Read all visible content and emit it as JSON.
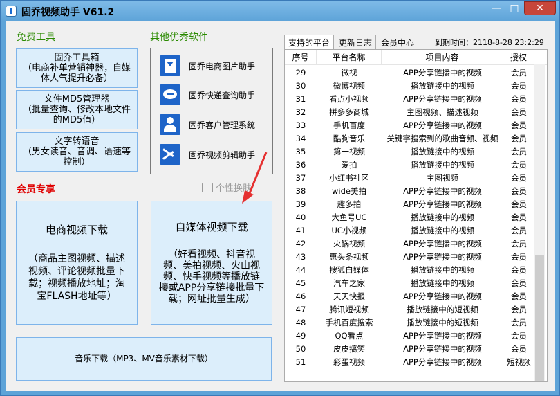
{
  "window": {
    "title": "固乔视频助手 V61.2",
    "minimize": "—",
    "maximize": "□",
    "close": "✕"
  },
  "free_tools": {
    "heading": "免费工具",
    "items": [
      {
        "line1": "固乔工具箱",
        "line2": "（电商补单营销神器，自媒",
        "line3": "体人气提升必备）"
      },
      {
        "line1": "文件MD5管理器",
        "line2": "（批量查询、修改本地文件",
        "line3": "的MD5值）"
      },
      {
        "line1": "文字转语音",
        "line2": "（男女读音、音调、语速等",
        "line3": "控制）"
      }
    ]
  },
  "other_software": {
    "heading": "其他优秀软件",
    "items": [
      {
        "label": "固乔电商图片助手",
        "icon": "download-icon"
      },
      {
        "label": "固乔快递查询助手",
        "icon": "express-icon"
      },
      {
        "label": "固乔客户管理系统",
        "icon": "customer-icon"
      },
      {
        "label": "固乔视频剪辑助手",
        "icon": "scissors-icon"
      }
    ]
  },
  "member": {
    "heading": "会员专享",
    "ecommerce": {
      "title": "电商视频下载",
      "l1": "（商品主图视频、描述",
      "l2": "视频、评论视频批量下",
      "l3": "载；视频播放地址；淘",
      "l4": "宝FLASH地址等）"
    },
    "selfmedia": {
      "title": "自媒体视频下载",
      "l1": "（好看视频、抖音视",
      "l2": "频、美拍视频、火山视",
      "l3": "频、快手视频等播放链",
      "l4": "接或APP分享链接批量下",
      "l5": "载；网址批量生成）"
    },
    "music": "音乐下载（MP3、MV音乐素材下载）"
  },
  "skin_label": "个性换肤",
  "tabs": [
    "支持的平台",
    "更新日志",
    "会员中心"
  ],
  "expiry": "到期时间：2118-8-28 23:2:29",
  "table": {
    "headers": [
      "序号",
      "平台名称",
      "项目内容",
      "授权"
    ],
    "rows": [
      [
        "29",
        "微视",
        "APP分享链接中的视频",
        "会员"
      ],
      [
        "30",
        "微博视频",
        "播放链接中的视频",
        "会员"
      ],
      [
        "31",
        "看点小视频",
        "APP分享链接中的视频",
        "会员"
      ],
      [
        "32",
        "拼多多商城",
        "主图视频、描述视频",
        "会员"
      ],
      [
        "33",
        "手机百度",
        "APP分享链接中的视频",
        "会员"
      ],
      [
        "34",
        "酷狗音乐",
        "关键字搜索到的歌曲音频、视频",
        "会员"
      ],
      [
        "35",
        "第一视频",
        "播放链接中的视频",
        "会员"
      ],
      [
        "36",
        "爱拍",
        "播放链接中的视频",
        "会员"
      ],
      [
        "37",
        "小红书社区",
        "主图视频",
        "会员"
      ],
      [
        "38",
        "wide美拍",
        "APP分享链接中的视频",
        "会员"
      ],
      [
        "39",
        "趣多拍",
        "APP分享链接中的视频",
        "会员"
      ],
      [
        "40",
        "大鱼号UC",
        "播放链接中的视频",
        "会员"
      ],
      [
        "41",
        "UC小视频",
        "播放链接中的视频",
        "会员"
      ],
      [
        "42",
        "火锅视频",
        "APP分享链接中的视频",
        "会员"
      ],
      [
        "43",
        "惠头条视频",
        "APP分享链接中的视频",
        "会员"
      ],
      [
        "44",
        "搜狐自媒体",
        "播放链接中的视频",
        "会员"
      ],
      [
        "45",
        "汽车之家",
        "播放链接中的视频",
        "会员"
      ],
      [
        "46",
        "天天快报",
        "APP分享链接中的视频",
        "会员"
      ],
      [
        "47",
        "腾讯短视频",
        "播放链接中的短视频",
        "会员"
      ],
      [
        "48",
        "手机百度搜索",
        "播放链接中的短视频",
        "会员"
      ],
      [
        "49",
        "QQ看点",
        "APP分享链接中的视频",
        "会员"
      ],
      [
        "50",
        "皮皮搞笑",
        "APP分享链接中的视频",
        "会员"
      ],
      [
        "51",
        "彩蛋视频",
        "APP分享链接中的视频",
        "短视频"
      ]
    ]
  }
}
